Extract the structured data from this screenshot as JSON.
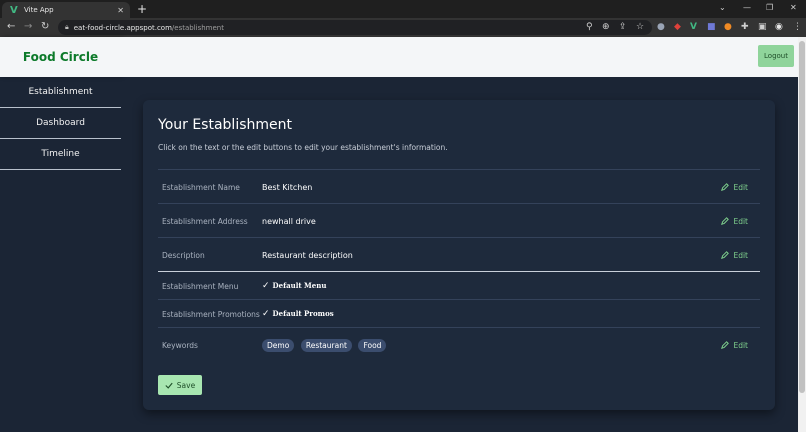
{
  "browser": {
    "tab_title": "Vite App",
    "tab_close": "✕",
    "new_tab": "+",
    "url_host": "eat-food-circle.appspot.com",
    "url_path": "/establishment",
    "window_controls": [
      "⌄",
      "—",
      "❐",
      "✕"
    ]
  },
  "sidebar": {
    "brand": "Food Circle",
    "items": [
      {
        "label": "Establishment"
      },
      {
        "label": "Dashboard"
      },
      {
        "label": "Timeline"
      }
    ]
  },
  "header": {
    "logout_label": "Logout"
  },
  "card": {
    "title": "Your Establishment",
    "subtitle": "Click on the text or the edit buttons to edit your establishment's information.",
    "edit_label": "Edit",
    "rows": [
      {
        "label": "Establishment Name",
        "value": "Best Kitchen"
      },
      {
        "label": "Establishment Address",
        "value": "newhall drive"
      },
      {
        "label": "Description",
        "value": "Restaurant description"
      },
      {
        "label": "Establishment Menu",
        "value": "Default  Menu"
      },
      {
        "label": "Establishment Promotions",
        "value": "Default  Promos"
      },
      {
        "label": "Keywords",
        "chips": [
          "Demo",
          "Restaurant",
          "Food"
        ]
      }
    ],
    "save_label": "Save"
  },
  "colors": {
    "brand": "#0c7a2a",
    "accent": "#7fd08d",
    "background": "#1b2535",
    "card": "#1e2a3c"
  }
}
